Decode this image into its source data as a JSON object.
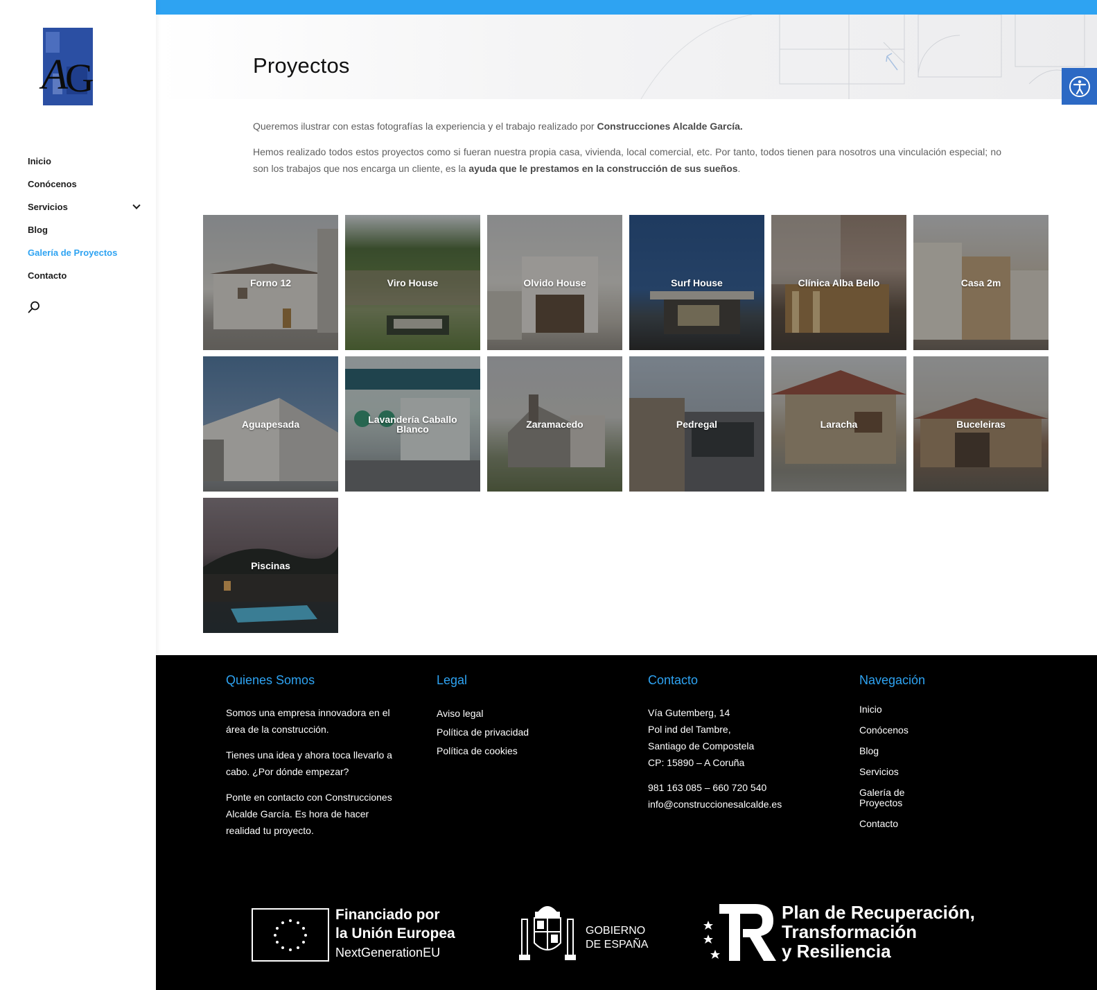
{
  "sidebar": {
    "logo_alt": "Alcalde García S.L. Construcciones",
    "nav": [
      {
        "label": "Inicio"
      },
      {
        "label": "Conócenos"
      },
      {
        "label": "Servicios"
      },
      {
        "label": "Blog"
      },
      {
        "label": "Galería de Proyectos"
      },
      {
        "label": "Contacto"
      }
    ],
    "search_icon": "search-icon"
  },
  "hero": {
    "title": "Proyectos"
  },
  "accessibility": {
    "icon": "accessibility-icon"
  },
  "intro": {
    "p1_text": "Queremos ilustrar con estas fotografías la experiencia y el trabajo realizado por ",
    "p1_bold": "Construcciones Alcalde García.",
    "p2_text": "Hemos realizado todos estos proyectos como si fueran nuestra propia casa, vivienda, local comercial, etc. Por tanto, todos tienen para nosotros una vinculación especial; no son los trabajos que nos encarga un cliente, es la ",
    "p2_bold": "ayuda que le prestamos en la construcción de sus sueños",
    "p2_end": "."
  },
  "gallery": [
    {
      "label": "Forno 12"
    },
    {
      "label": "Viro House"
    },
    {
      "label": "Olvido House"
    },
    {
      "label": "Surf House"
    },
    {
      "label": "Clínica Alba Bello"
    },
    {
      "label": "Casa 2m"
    },
    {
      "label": "Aguapesada"
    },
    {
      "label": "Lavandería Caballo Blanco"
    },
    {
      "label": "Zaramacedo"
    },
    {
      "label": "Pedregal"
    },
    {
      "label": "Laracha"
    },
    {
      "label": "Buceleiras"
    },
    {
      "label": "Piscinas"
    }
  ],
  "footer": {
    "about": {
      "title": "Quienes Somos",
      "p1": "Somos una empresa innovadora en el área de la construcción.",
      "p2": "Tienes una idea y ahora toca llevarlo a cabo. ¿Por dónde empezar?",
      "p3": "Ponte en contacto con Construcciones Alcalde García. Es hora de hacer realidad tu proyecto."
    },
    "legal": {
      "title": "Legal",
      "links": [
        "Aviso legal",
        "Política de privacidad",
        "Política de cookies"
      ]
    },
    "contact": {
      "title": "Contacto",
      "address": [
        "Vía Gutemberg, 14",
        "Pol ind del Tambre,",
        "Santiago de Compostela",
        "CP: 15890 – A Coruña"
      ],
      "phone": "981 163 085 – 660 720 540",
      "email": "info@construccionesalcalde.es"
    },
    "navigation": {
      "title": "Navegación",
      "links": [
        "Inicio",
        "Conócenos",
        "Blog",
        "Servicios",
        "Galería de Proyectos",
        "Contacto"
      ]
    },
    "funding": {
      "eu_line1": "Financiado por",
      "eu_line2": "la Unión Europea",
      "eu_line3": "NextGenerationEU",
      "gov_line1": "GOBIERNO",
      "gov_line2": "DE ESPAÑA",
      "prtr_line1": "Plan de Recuperación,",
      "prtr_line2": "Transformación",
      "prtr_line3": "y Resiliencia"
    }
  },
  "colors": {
    "accent": "#2ea3f2",
    "access_btn": "#2c69c4",
    "footer_bg": "#000000"
  }
}
